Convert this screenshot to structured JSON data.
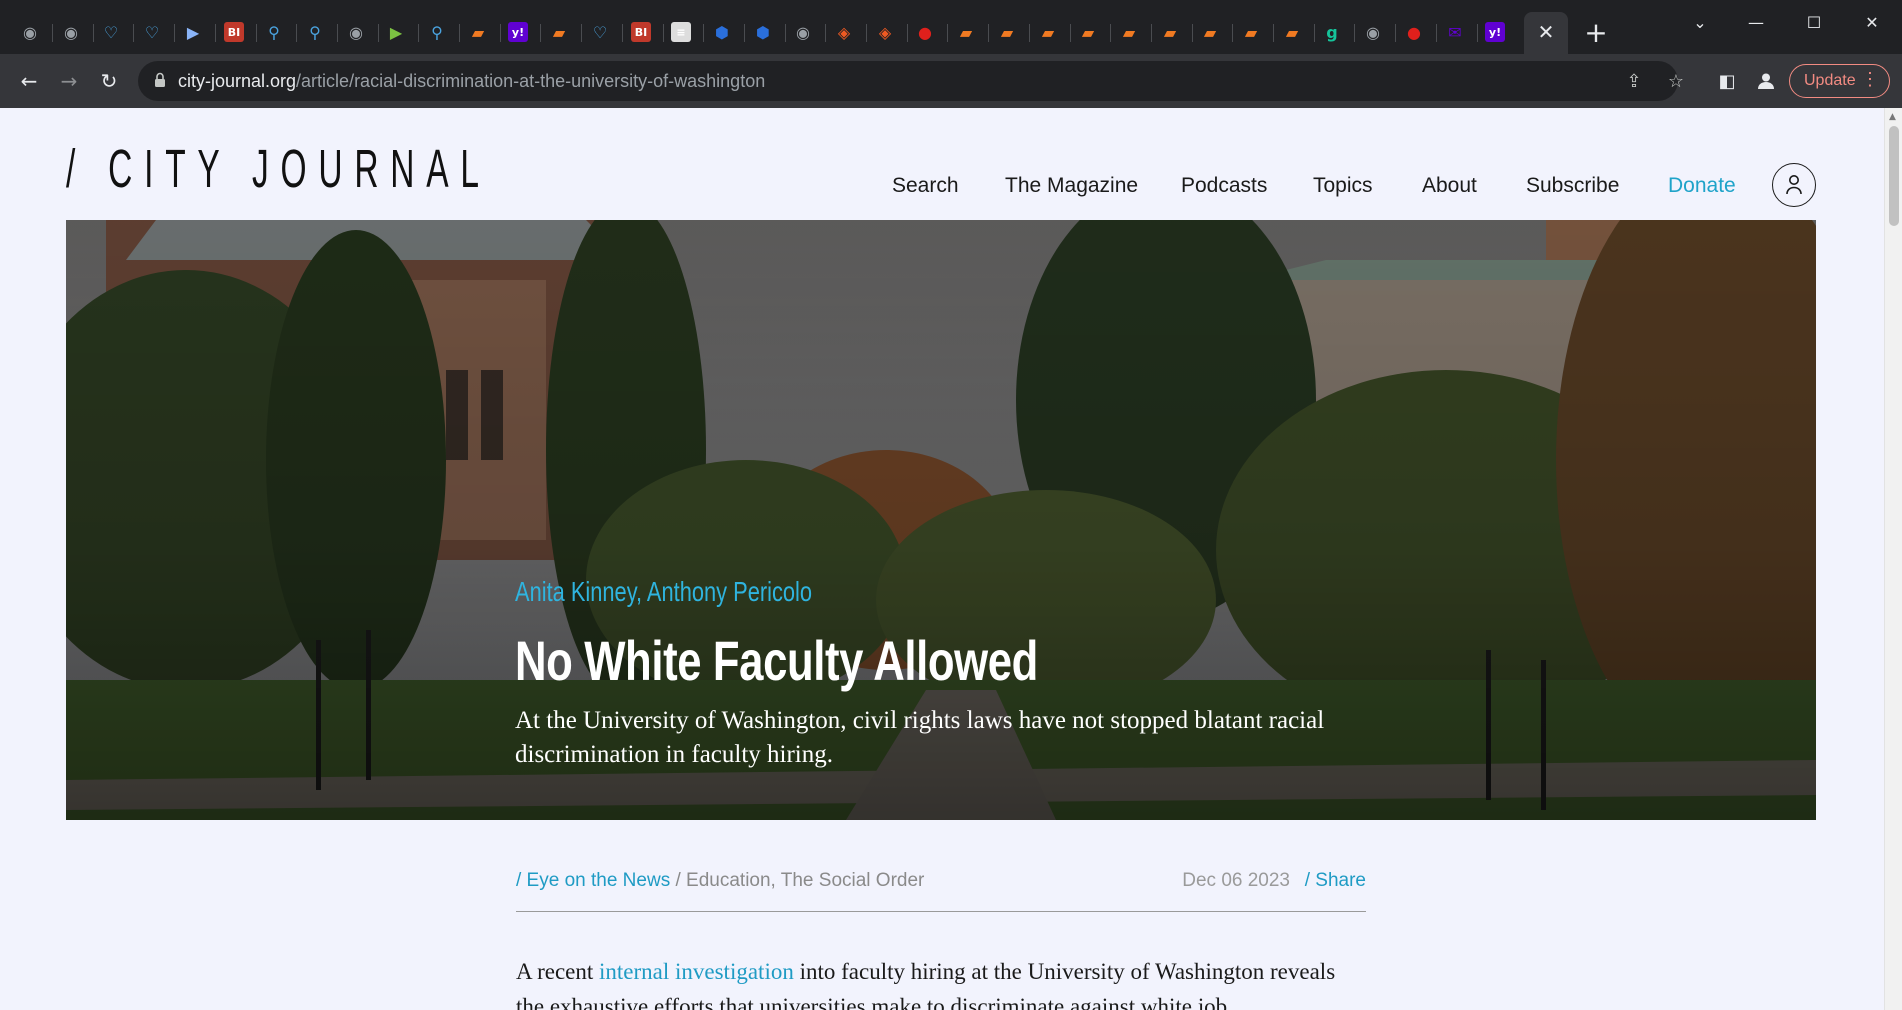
{
  "browser": {
    "tabs": [
      {
        "icon": "globe-icon",
        "color": "#9aa0a6",
        "glyph": "◉"
      },
      {
        "icon": "globe-icon",
        "color": "#9aa0a6",
        "glyph": "◉"
      },
      {
        "icon": "shield-icon",
        "color": "#4aa3df",
        "glyph": "♡"
      },
      {
        "icon": "shield-icon",
        "color": "#4aa3df",
        "glyph": "♡"
      },
      {
        "icon": "label-icon",
        "color": "#8ab4f8",
        "glyph": "▶"
      },
      {
        "icon": "bi-icon",
        "color": "#c0392b",
        "glyph": "BI"
      },
      {
        "icon": "search-icon",
        "color": "#4aa3df",
        "glyph": "⚲"
      },
      {
        "icon": "search-icon",
        "color": "#4aa3df",
        "glyph": "⚲"
      },
      {
        "icon": "globe-icon",
        "color": "#9aa0a6",
        "glyph": "◉"
      },
      {
        "icon": "play-icon",
        "color": "#7cc242",
        "glyph": "▶"
      },
      {
        "icon": "search-icon",
        "color": "#4aa3df",
        "glyph": "⚲"
      },
      {
        "icon": "bookmark-icon",
        "color": "#f07a22",
        "glyph": "▰"
      },
      {
        "icon": "yahoo-icon",
        "color": "#6001d2",
        "glyph": "y!"
      },
      {
        "icon": "bookmark-icon",
        "color": "#f07a22",
        "glyph": "▰"
      },
      {
        "icon": "shield-icon",
        "color": "#4aa3df",
        "glyph": "♡"
      },
      {
        "icon": "bi-icon",
        "color": "#c0392b",
        "glyph": "BI"
      },
      {
        "icon": "news-icon",
        "color": "#dddddd",
        "glyph": "≡"
      },
      {
        "icon": "cube-icon",
        "color": "#2a6fdb",
        "glyph": "⬢"
      },
      {
        "icon": "cube-icon",
        "color": "#2a6fdb",
        "glyph": "⬢"
      },
      {
        "icon": "globe-icon",
        "color": "#9aa0a6",
        "glyph": "◉"
      },
      {
        "icon": "brave-icon",
        "color": "#f05a22",
        "glyph": "◈"
      },
      {
        "icon": "brave-icon",
        "color": "#f05a22",
        "glyph": "◈"
      },
      {
        "icon": "pin-icon",
        "color": "#e0201c",
        "glyph": "●"
      },
      {
        "icon": "bookmark-icon",
        "color": "#f07a22",
        "glyph": "▰"
      },
      {
        "icon": "bookmark-icon",
        "color": "#f07a22",
        "glyph": "▰"
      },
      {
        "icon": "bookmark-icon",
        "color": "#f07a22",
        "glyph": "▰"
      },
      {
        "icon": "bookmark-icon",
        "color": "#f07a22",
        "glyph": "▰"
      },
      {
        "icon": "bookmark-icon",
        "color": "#f07a22",
        "glyph": "▰"
      },
      {
        "icon": "bookmark-icon",
        "color": "#f07a22",
        "glyph": "▰"
      },
      {
        "icon": "bookmark-icon",
        "color": "#f07a22",
        "glyph": "▰"
      },
      {
        "icon": "bookmark-icon",
        "color": "#f07a22",
        "glyph": "▰"
      },
      {
        "icon": "bookmark-icon",
        "color": "#f07a22",
        "glyph": "▰"
      },
      {
        "icon": "g-icon",
        "color": "#15c39a",
        "glyph": "g"
      },
      {
        "icon": "globe-icon",
        "color": "#9aa0a6",
        "glyph": "◉"
      },
      {
        "icon": "pin-icon",
        "color": "#e0201c",
        "glyph": "●"
      },
      {
        "icon": "mail-icon",
        "color": "#6001d2",
        "glyph": "✉"
      },
      {
        "icon": "yahoo-icon",
        "color": "#6001d2",
        "glyph": "y!"
      }
    ],
    "active_tab_close": "✕",
    "new_tab": "+",
    "window_controls": {
      "tab_search": "⌄",
      "minimize": "—",
      "maximize": "☐",
      "close": "✕"
    },
    "nav": {
      "back": "←",
      "forward": "→",
      "reload": "↻"
    },
    "url_host": "city-journal.org",
    "url_path": "/article/racial-discrimination-at-the-university-of-washington",
    "omnibox_icons": {
      "share": "⇪",
      "bookmark": "☆"
    },
    "toolbar_icons": {
      "side_panel": "◧",
      "profile": "●"
    },
    "update_label": "Update",
    "menu_dots": "⋮"
  },
  "site": {
    "logo": "/ CITY JOURNAL",
    "nav": [
      "Search",
      "The Magazine",
      "Podcasts",
      "Topics",
      "About",
      "Subscribe"
    ],
    "donate": "Donate",
    "accent_color": "#1fa3c9"
  },
  "article": {
    "authors": "Anita Kinney, Anthony Pericolo",
    "title": "No White Faculty Allowed",
    "dek": "At the University of Washington, civil rights laws have not stopped blatant racial discrimination in faculty hiring.",
    "category": "/ Eye on the News",
    "topics": "/ Education, The Social Order",
    "date": "Dec 06 2023",
    "share": "/ Share",
    "body_intro": "A recent ",
    "body_link": "internal investigation",
    "body_rest": " into faculty hiring at the University of Washington reveals the exhaustive efforts that universities make to discriminate against white job"
  }
}
